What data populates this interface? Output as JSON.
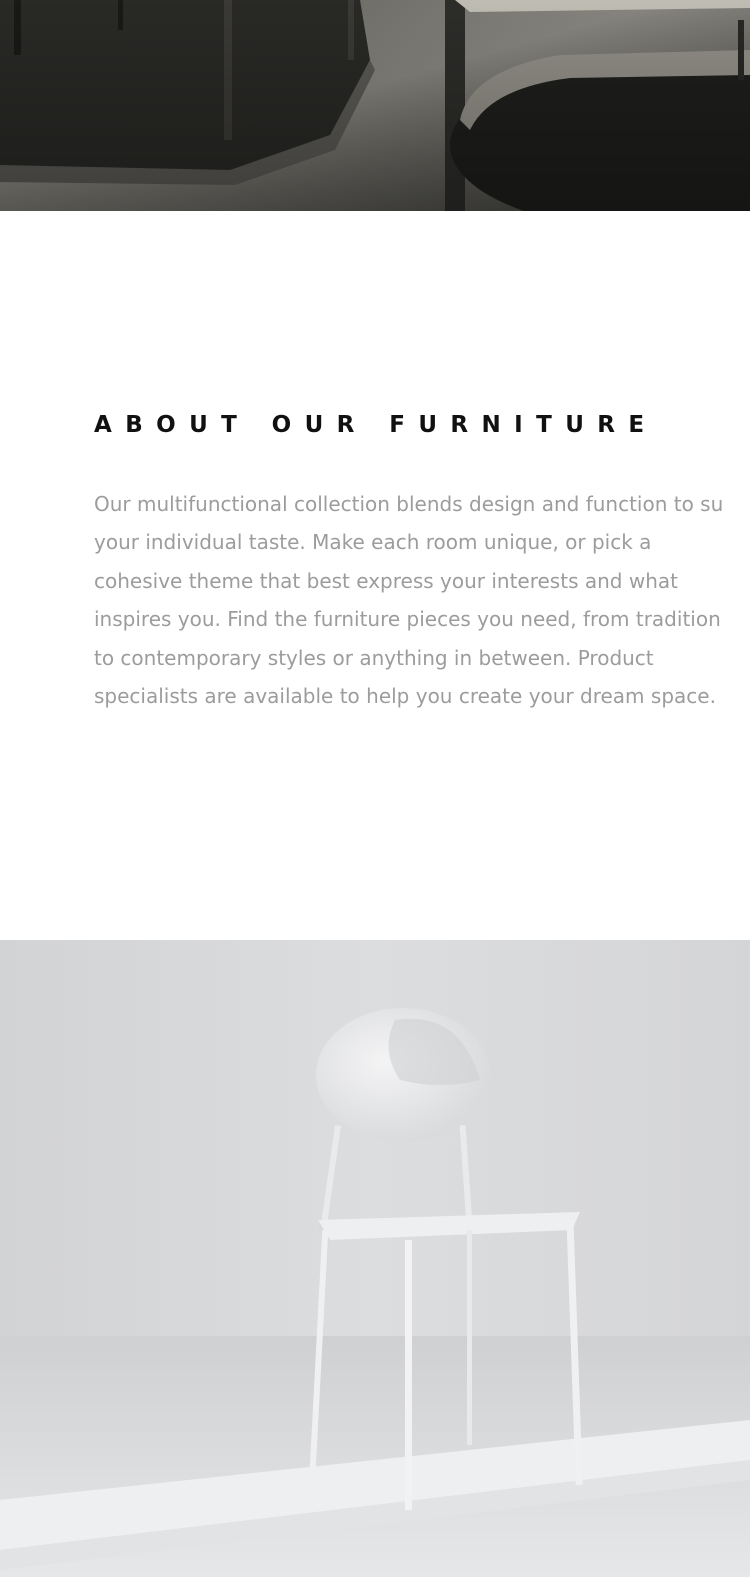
{
  "hero_top": {
    "image": "furniture-table-photo"
  },
  "about": {
    "title": "ABOUT OUR FURNITURE",
    "lines": [
      "Our multifunctional collection blends design and function to su",
      "your individual taste. Make each room unique, or pick a",
      "cohesive theme that best express your interests and what",
      "inspires you. Find the furniture pieces you need, from tradition",
      "to contemporary styles or anything in between. Product",
      "specialists are available to help you create your dream space."
    ]
  },
  "hero_bottom": {
    "image": "white-chair-photo"
  },
  "colors": {
    "title": "#111111",
    "body_text": "#9c9c9c",
    "dark_photo": "#2a2a27",
    "light_photo": "#d6d7d9"
  }
}
